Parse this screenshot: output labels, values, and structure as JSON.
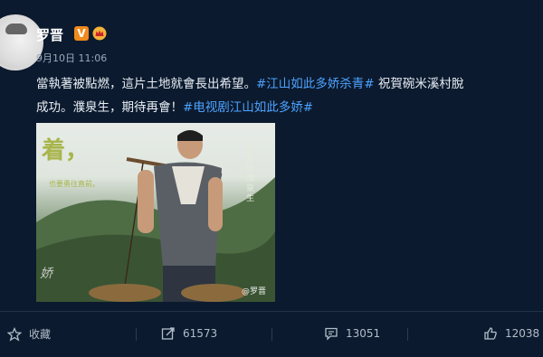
{
  "user": {
    "name": "罗晋",
    "verified_mark": "V",
    "time": "9月10日 11:06"
  },
  "post": {
    "line1_text": "當執著被點燃，這片土地就會長出希望。",
    "tag1": "#江山如此多娇杀青#",
    "line1_tail": " 祝賀碗米溪村脫",
    "line2_text": "成功。濮泉生，期待再會！",
    "tag2": "#电视剧江山如此多娇#"
  },
  "image": {
    "big_text": "着，",
    "small_text": "也要勇往直前。",
    "vertical_text": "罗晋 饰 濮泉生",
    "watermark": "@罗晋",
    "script_text": "娇"
  },
  "actions": {
    "favorite_label": "收藏",
    "repost_count": "61573",
    "comment_count": "13051",
    "like_count": "12038"
  }
}
